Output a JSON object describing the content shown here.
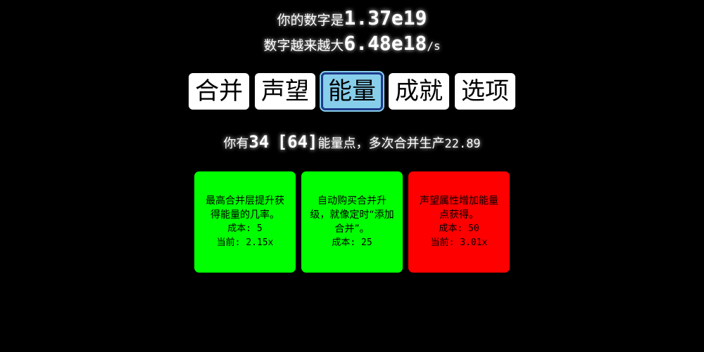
{
  "header": {
    "number_label": "你的数字是",
    "number_value": "1.37e19",
    "rate_label": "数字越来越大",
    "rate_value": "6.48e18",
    "rate_unit": "/s"
  },
  "tabs": [
    {
      "label": "合并",
      "active": false
    },
    {
      "label": "声望",
      "active": false
    },
    {
      "label": "能量",
      "active": true
    },
    {
      "label": "成就",
      "active": false
    },
    {
      "label": "选项",
      "active": false
    }
  ],
  "energy_info": {
    "prefix": "你有",
    "points": "34",
    "bracket_points": "[64]",
    "middle": "能量点，多次合并生产",
    "production": "22.89"
  },
  "upgrades": [
    {
      "description": "最高合并层提升获得能量的几率。",
      "cost": "成本: 5",
      "current": "当前: 2.15x",
      "color": "#00ff00"
    },
    {
      "description": "自动购买合并升级，就像定时“添加合并”。",
      "cost": "成本: 25",
      "current": "",
      "color": "#00ff00"
    },
    {
      "description": "声望属性增加能量点获得。",
      "cost": "成本: 50",
      "current": "当前: 3.01x",
      "color": "#ff0000"
    }
  ],
  "colors": {
    "background": "#000000",
    "tab_active": "#87ceeb",
    "tab_active_border": "#1e3a8a",
    "affordable": "#00ff00",
    "unaffordable": "#ff0000"
  }
}
